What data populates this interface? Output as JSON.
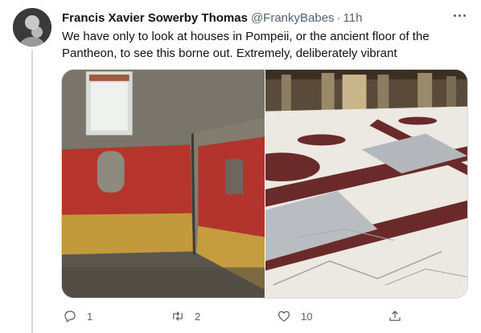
{
  "tweet": {
    "display_name": "Francis Xavier Sowerby Thomas",
    "handle": "@FrankyBabes",
    "separator": "·",
    "timestamp": "11h",
    "text": "We have only to look at houses in Pompeii, or the ancient floor of the Pantheon, to see this borne out. Extremely, deliberately vibrant"
  },
  "media": {
    "images": [
      {
        "subject": "Pompeii house interior with red painted walls"
      },
      {
        "subject": "Pantheon marble floor"
      }
    ]
  },
  "actions": {
    "reply": {
      "icon": "reply-icon",
      "count": "1"
    },
    "retweet": {
      "icon": "retweet-icon",
      "count": "2"
    },
    "like": {
      "icon": "heart-icon",
      "count": "10"
    },
    "share": {
      "icon": "share-icon",
      "count": ""
    }
  },
  "colors": {
    "text_primary": "#0f1419",
    "text_secondary": "#536471",
    "border": "#cfd9de",
    "pompeii_red": "#b5352c",
    "porphyry": "#6b2a2a"
  }
}
